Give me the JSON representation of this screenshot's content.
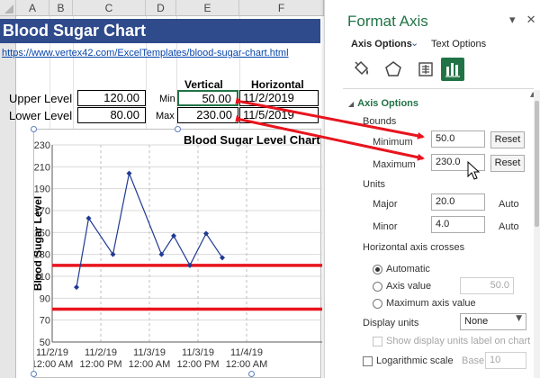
{
  "sheet": {
    "columns": [
      "A",
      "B",
      "C",
      "D",
      "E",
      "F"
    ],
    "title": "Blood Sugar Chart",
    "link": "https://www.vertex42.com/ExcelTemplates/blood-sugar-chart.html",
    "vertical_header": "Vertical",
    "horizontal_header": "Horizontal",
    "upper_level_label": "Upper Level",
    "upper_level_value": "120.00",
    "lower_level_label": "Lower Level",
    "lower_level_value": "80.00",
    "min_label": "Min",
    "min_value": "50.00",
    "max_label": "Max",
    "max_value": "230.00",
    "horiz_min": "11/2/2019",
    "horiz_max": "11/5/2019"
  },
  "chart_data": {
    "type": "line",
    "title": "Blood Sugar Level Chart",
    "ylabel": "Blood Sugar Level",
    "xlabel": "",
    "ylim": [
      50,
      230
    ],
    "y_ticks": [
      50,
      70,
      90,
      110,
      130,
      150,
      170,
      190,
      210,
      230
    ],
    "x_ticks": [
      {
        "date": "11/2/19",
        "time": "12:00 AM"
      },
      {
        "date": "11/2/19",
        "time": "12:00 PM"
      },
      {
        "date": "11/3/19",
        "time": "12:00 AM"
      },
      {
        "date": "11/3/19",
        "time": "12:00 PM"
      },
      {
        "date": "11/4/19",
        "time": "12:00 AM"
      }
    ],
    "x_values_hours": [
      6,
      9,
      15,
      19,
      27,
      30,
      34,
      38,
      42
    ],
    "series": [
      {
        "values": [
          100,
          163,
          130,
          204,
          130,
          147,
          120,
          149,
          127
        ],
        "color": "#1f3a93"
      }
    ],
    "reference_lines": [
      {
        "value": 120,
        "color": "#e8141e"
      },
      {
        "value": 80,
        "color": "#e8141e"
      }
    ],
    "grid": true
  },
  "pane": {
    "title": "Format Axis",
    "tab_axis_options": "Axis Options",
    "tab_text_options": "Text Options",
    "section_axis_options": "Axis Options",
    "bounds_label": "Bounds",
    "minimum_label": "Minimum",
    "minimum_value": "50.0",
    "maximum_label": "Maximum",
    "maximum_value": "230.0",
    "reset_label": "Reset",
    "units_label": "Units",
    "major_label": "Major",
    "major_value": "20.0",
    "minor_label": "Minor",
    "minor_value": "4.0",
    "auto_label": "Auto",
    "crosses_label": "Horizontal axis crosses",
    "automatic_label": "Automatic",
    "axis_value_label": "Axis value",
    "axis_value_value": "50.0",
    "max_axis_value_label": "Maximum axis value",
    "display_units_label": "Display units",
    "display_units_value": "None",
    "show_units_label": "Show display units label on chart",
    "log_scale_label": "Logarithmic scale",
    "base_label": "Base",
    "base_value": "10"
  },
  "colors": {
    "excel_green": "#217346",
    "title_blue": "#2f4b8c",
    "series_line": "#1f3a93",
    "limit_line": "#e8141e",
    "arrow": "#e8141e"
  }
}
